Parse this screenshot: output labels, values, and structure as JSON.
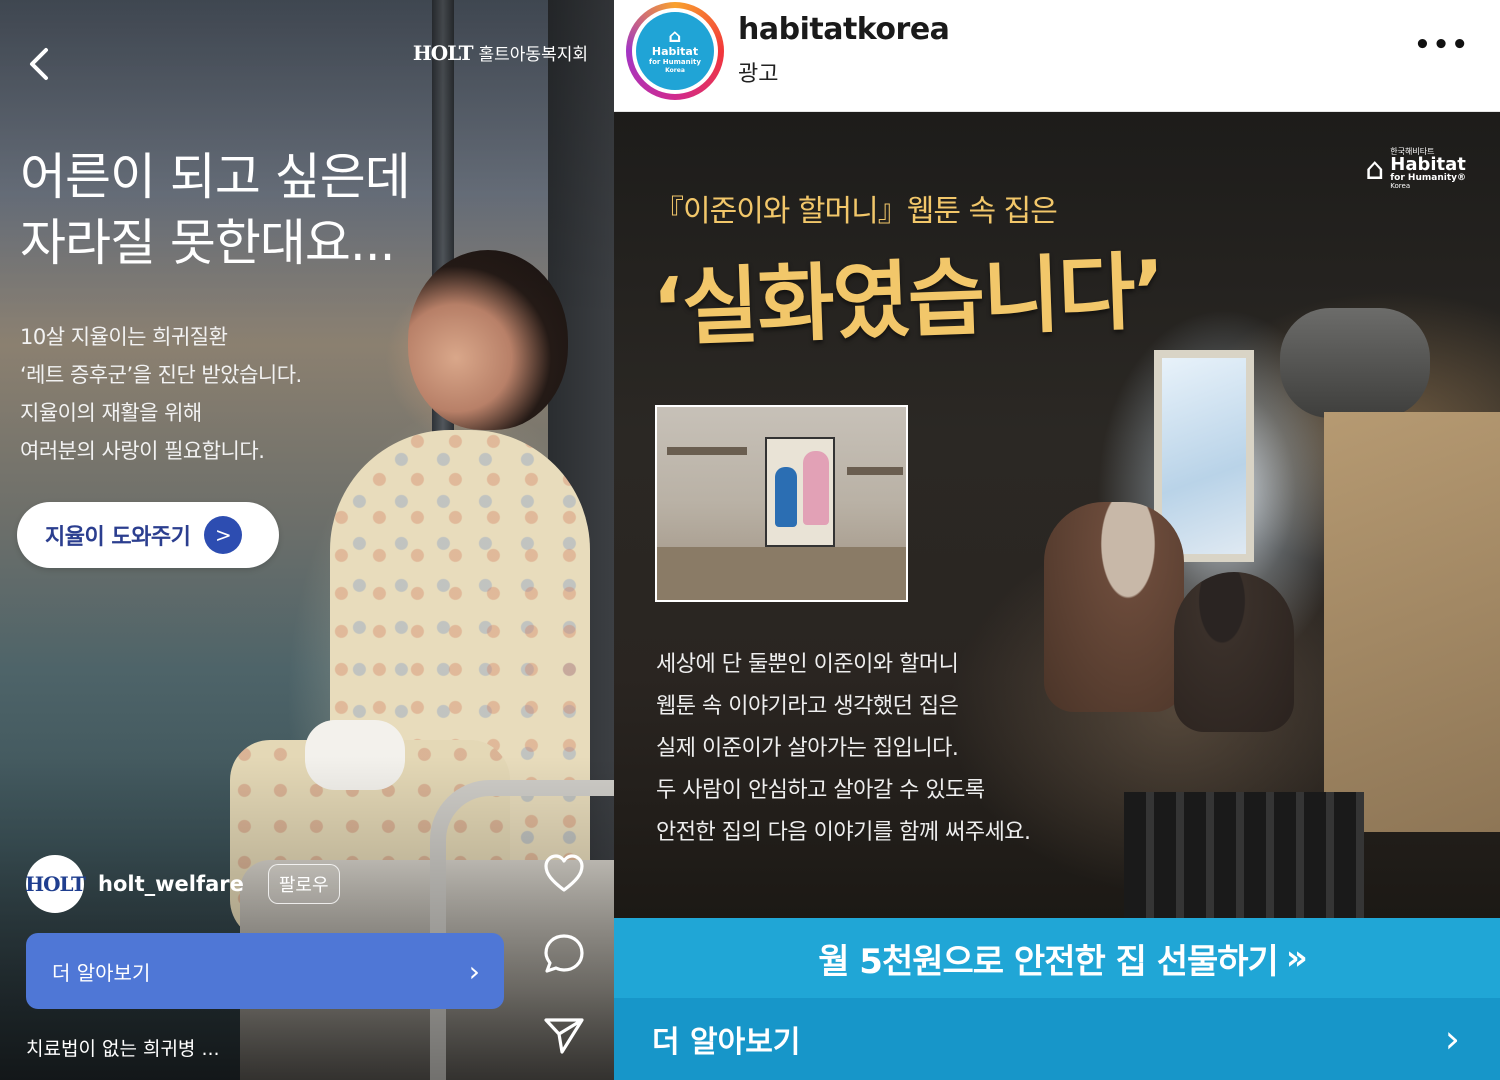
{
  "left_ad": {
    "brand_logo_text": "HOLT",
    "brand_name": "홀트아동복지회",
    "headline_line1": "어른이 되고 싶은데",
    "headline_line2": "자라질 못한대요...",
    "description": [
      "10살 지율이는 희귀질환",
      "‘레트 증후군’을 진단 받았습니다.",
      "지율이의 재활을 위해",
      "여러분의 사랑이 필요합니다."
    ],
    "help_button": "지율이 도와주기",
    "account_name": "holt_welfare",
    "follow_label": "팔로우",
    "learn_more": "더 알아보기",
    "caption": "치료법이 없는 희귀병 ...",
    "icons": {
      "back": "chevron-left-icon",
      "like": "heart-icon",
      "comment": "comment-icon",
      "share": "send-icon"
    }
  },
  "right_ad": {
    "account_name": "habitatkorea",
    "sponsored_label": "광고",
    "more_label": "•••",
    "avatar_text": {
      "line1": "Habitat",
      "line2": "for Humanity",
      "line3": "Korea"
    },
    "logo": {
      "line0": "한국해비타트",
      "line1": "Habitat",
      "line2": "for Humanity®",
      "line3": "Korea"
    },
    "subtitle": "『이준이와 할머니』웹툰 속 집은",
    "title": "‘실화였습니다’",
    "body": [
      "세상에 단 둘뿐인 이준이와 할머니",
      "웹툰 속 이야기라고 생각했던 집은",
      "실제 이준이가 살아가는 집입니다.",
      "두 사람이 안심하고 살아갈 수 있도록",
      "안전한 집의 다음 이야기를 함께 써주세요."
    ],
    "cta": "월 5천원으로 안전한 집 선물하기",
    "cta_chevrons": "»",
    "learn_more": "더 알아보기",
    "colors": {
      "cta_bg": "#20a6d6",
      "learn_bg": "#1796c9",
      "title_gold": "#f2c76a"
    }
  }
}
